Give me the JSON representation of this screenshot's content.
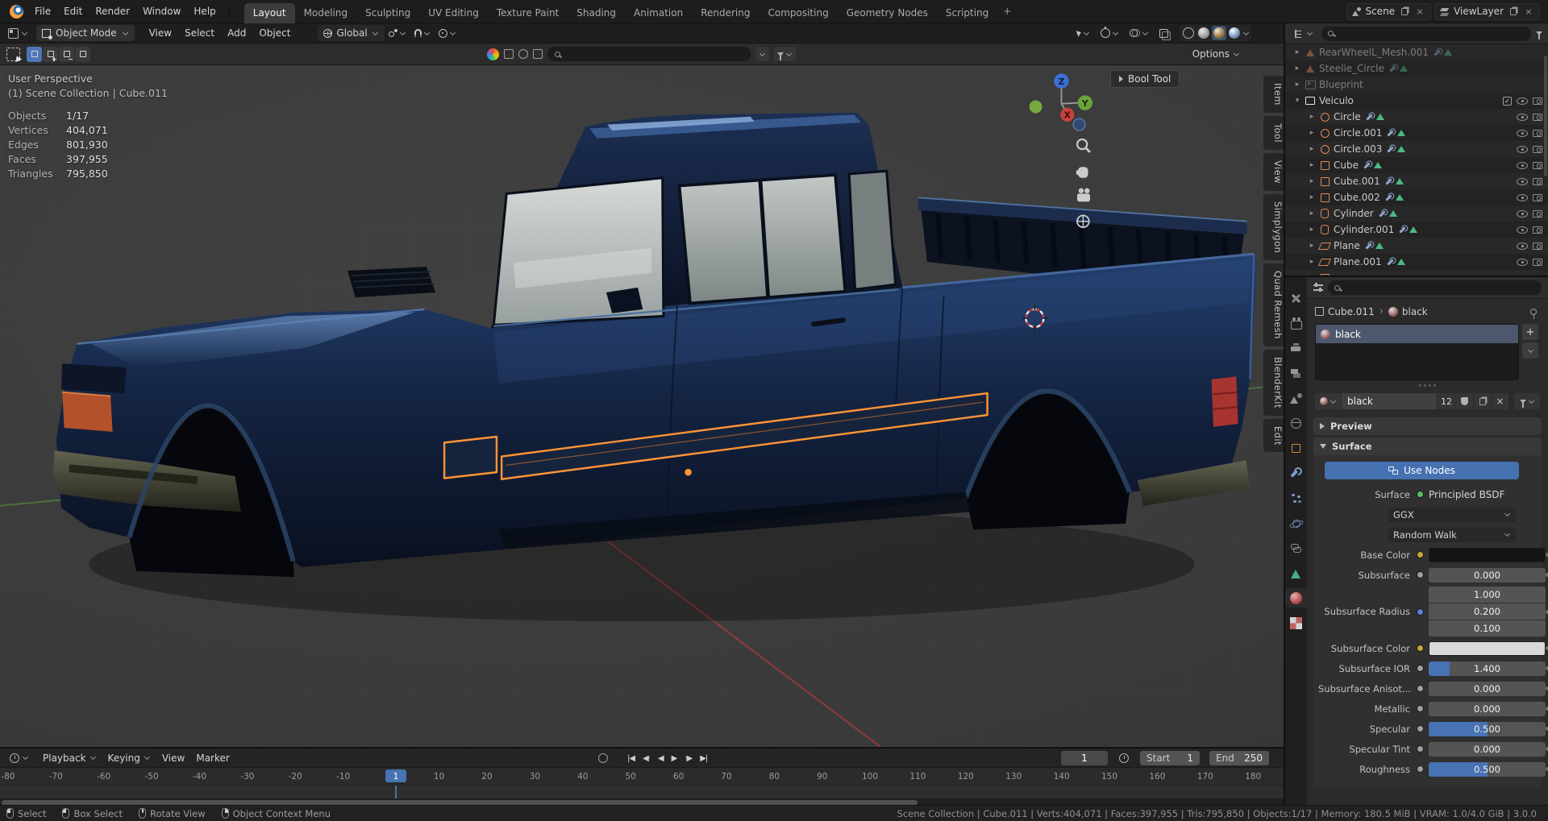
{
  "topbar": {
    "menus": [
      {
        "label": "File"
      },
      {
        "label": "Edit"
      },
      {
        "label": "Render"
      },
      {
        "label": "Window"
      },
      {
        "label": "Help"
      }
    ],
    "workspaces": [
      {
        "label": "Layout",
        "active": true
      },
      {
        "label": "Modeling"
      },
      {
        "label": "Sculpting"
      },
      {
        "label": "UV Editing"
      },
      {
        "label": "Texture Paint"
      },
      {
        "label": "Shading"
      },
      {
        "label": "Animation"
      },
      {
        "label": "Rendering"
      },
      {
        "label": "Compositing"
      },
      {
        "label": "Geometry Nodes"
      },
      {
        "label": "Scripting"
      }
    ],
    "add_workspace_label": "+",
    "scene_label": "Scene",
    "view_layer_label": "ViewLayer"
  },
  "viewport_header": {
    "mode_label": "Object Mode",
    "menus": [
      {
        "label": "View"
      },
      {
        "label": "Select"
      },
      {
        "label": "Add"
      },
      {
        "label": "Object"
      }
    ],
    "orientation_label": "Global"
  },
  "tool_settings": {
    "options_label": "Options",
    "search_placeholder": ""
  },
  "viewport": {
    "perspective_label": "User Perspective",
    "context_label": "(1) Scene Collection | Cube.011",
    "stats": [
      {
        "label": "Objects",
        "value": "1/17"
      },
      {
        "label": "Vertices",
        "value": "404,071"
      },
      {
        "label": "Edges",
        "value": "801,930"
      },
      {
        "label": "Faces",
        "value": "397,955"
      },
      {
        "label": "Triangles",
        "value": "795,850"
      }
    ],
    "bool_tool_label": "Bool Tool",
    "axis": {
      "x": "X",
      "y": "Y",
      "z": "Z"
    },
    "colors": {
      "axis_x": "#c8433f",
      "axis_y": "#6ba33b",
      "axis_z": "#3d6fd8",
      "selection_outline": "#ff9435"
    }
  },
  "sidebar_tabs": [
    {
      "label": "Item"
    },
    {
      "label": "Tool"
    },
    {
      "label": "View"
    },
    {
      "label": "Simplygon"
    },
    {
      "label": "Quad Remesh"
    },
    {
      "label": "BlenderKit"
    },
    {
      "label": "Edit"
    }
  ],
  "outliner": {
    "rows": [
      {
        "arrow": "▸",
        "name": "RearWheelL_Mesh.001",
        "icon": "mesh",
        "dim": true,
        "aux": true
      },
      {
        "arrow": "▸",
        "name": "Steelie_Circle",
        "icon": "mesh",
        "dim": true,
        "aux": true
      },
      {
        "arrow": "▸",
        "name": "Blueprint",
        "icon": "image",
        "dim": true
      },
      {
        "arrow": "▾",
        "name": "Veiculo",
        "icon": "collection",
        "chk": true,
        "eye": true,
        "cam": true
      },
      {
        "arrow": "▸",
        "name": "Circle",
        "icon": "circle",
        "child": true,
        "aux": true,
        "eye": true,
        "cam": true
      },
      {
        "arrow": "▸",
        "name": "Circle.001",
        "icon": "circle",
        "child": true,
        "aux": true,
        "eye": true,
        "cam": true
      },
      {
        "arrow": "▸",
        "name": "Circle.003",
        "icon": "circle",
        "child": true,
        "aux": true,
        "eye": true,
        "cam": true
      },
      {
        "arrow": "▸",
        "name": "Cube",
        "icon": "cube",
        "child": true,
        "aux": true,
        "eye": true,
        "cam": true
      },
      {
        "arrow": "▸",
        "name": "Cube.001",
        "icon": "cube",
        "child": true,
        "aux": true,
        "eye": true,
        "cam": true
      },
      {
        "arrow": "▸",
        "name": "Cube.002",
        "icon": "cube",
        "child": true,
        "aux": true,
        "eye": true,
        "cam": true
      },
      {
        "arrow": "▸",
        "name": "Cylinder",
        "icon": "cylinder",
        "child": true,
        "aux": true,
        "eye": true,
        "cam": true
      },
      {
        "arrow": "▸",
        "name": "Cylinder.001",
        "icon": "cylinder",
        "child": true,
        "aux": true,
        "eye": true,
        "cam": true
      },
      {
        "arrow": "▸",
        "name": "Plane",
        "icon": "plane",
        "child": true,
        "aux": true,
        "eye": true,
        "cam": true
      },
      {
        "arrow": "▸",
        "name": "Plane.001",
        "icon": "plane",
        "child": true,
        "aux": true,
        "eye": true,
        "cam": true
      },
      {
        "arrow": "▸",
        "name": "",
        "icon": "cube",
        "child": true
      }
    ]
  },
  "properties": {
    "tabs": [
      {
        "icon": "tool",
        "name": "tab-tool"
      },
      {
        "icon": "render",
        "name": "tab-render"
      },
      {
        "icon": "output",
        "name": "tab-output"
      },
      {
        "icon": "view-layer",
        "name": "tab-view-layer"
      },
      {
        "icon": "scene",
        "name": "tab-scene"
      },
      {
        "icon": "world",
        "name": "tab-world"
      },
      {
        "icon": "object",
        "name": "tab-object"
      },
      {
        "icon": "modifiers",
        "name": "tab-modifiers"
      },
      {
        "icon": "particles",
        "name": "tab-particles"
      },
      {
        "icon": "physics",
        "name": "tab-physics"
      },
      {
        "icon": "constraints",
        "name": "tab-constraints"
      },
      {
        "icon": "object-data",
        "name": "tab-object-data"
      },
      {
        "icon": "material",
        "name": "tab-material",
        "active": true
      },
      {
        "icon": "texture",
        "name": "tab-texture"
      }
    ],
    "breadcrumb": {
      "object": "Cube.011",
      "material": "black"
    },
    "slots": [
      {
        "name": "black"
      }
    ],
    "datablock": {
      "name": "black",
      "users": "12"
    },
    "preview_label": "Preview",
    "surface": {
      "title": "Surface",
      "use_nodes": "Use Nodes",
      "surface_label": "Surface",
      "bsdf": "Principled BSDF",
      "distribution": "GGX",
      "method": "Random Walk",
      "rows": {
        "base_color": {
          "label": "Base Color",
          "swatch": "#141414"
        },
        "subsurface": {
          "label": "Subsurface",
          "value": "0.000"
        },
        "radius": {
          "label": "Subsurface Radius",
          "v1": "1.000",
          "v2": "0.200",
          "v3": "0.100"
        },
        "ss_color": {
          "label": "Subsurface Color",
          "swatch": "#d9d9d9"
        },
        "ior": {
          "label": "Subsurface IOR",
          "value": "1.400"
        },
        "aniso": {
          "label": "Subsurface Anisot...",
          "value": "0.000"
        },
        "metallic": {
          "label": "Metallic",
          "value": "0.000"
        },
        "specular": {
          "label": "Specular",
          "value": "0.500"
        },
        "spec_tint": {
          "label": "Specular Tint",
          "value": "0.000"
        },
        "roughness": {
          "label": "Roughness",
          "value": "0.500"
        }
      }
    }
  },
  "timeline": {
    "menus": [
      {
        "label": "Playback",
        "chev": true
      },
      {
        "label": "Keying",
        "chev": true
      },
      {
        "label": "View"
      },
      {
        "label": "Marker"
      }
    ],
    "transport": [
      {
        "glyph": "|◀",
        "name": "jump-to-start-button"
      },
      {
        "glyph": "◀·",
        "name": "prev-keyframe-button"
      },
      {
        "glyph": "◀",
        "name": "play-reverse-button"
      },
      {
        "glyph": "▶",
        "name": "play-button"
      },
      {
        "glyph": "·▶",
        "name": "next-keyframe-button"
      },
      {
        "glyph": "▶|",
        "name": "jump-to-end-button"
      }
    ],
    "current_frame": "1",
    "start_label": "Start",
    "start_value": "1",
    "end_label": "End",
    "end_value": "250",
    "playhead": "1",
    "ticks": [
      {
        "v": "-80"
      },
      {
        "v": "-70"
      },
      {
        "v": "-60"
      },
      {
        "v": "-50"
      },
      {
        "v": "-40"
      },
      {
        "v": "-30"
      },
      {
        "v": "-20"
      },
      {
        "v": "-10"
      },
      {
        "v": "10"
      },
      {
        "v": "20"
      },
      {
        "v": "30"
      },
      {
        "v": "40"
      },
      {
        "v": "50"
      },
      {
        "v": "60"
      },
      {
        "v": "70"
      },
      {
        "v": "80"
      },
      {
        "v": "90"
      },
      {
        "v": "100"
      },
      {
        "v": "110"
      },
      {
        "v": "120"
      },
      {
        "v": "130"
      },
      {
        "v": "140"
      },
      {
        "v": "150"
      },
      {
        "v": "160"
      },
      {
        "v": "170"
      },
      {
        "v": "180"
      }
    ]
  },
  "status_bar": {
    "hints": [
      {
        "label": "Select",
        "mouse": "left"
      },
      {
        "label": "Box Select",
        "mouse": "left"
      },
      {
        "label": "Rotate View",
        "mouse": "middle"
      },
      {
        "label": "Object Context Menu",
        "mouse": "right"
      }
    ],
    "info": "Scene Collection | Cube.011 | Verts:404,071 | Faces:397,955 | Tris:795,850 | Objects:1/17 | Memory: 180.5 MiB | VRAM: 1.0/4.0 GiB | 3.0.0"
  }
}
